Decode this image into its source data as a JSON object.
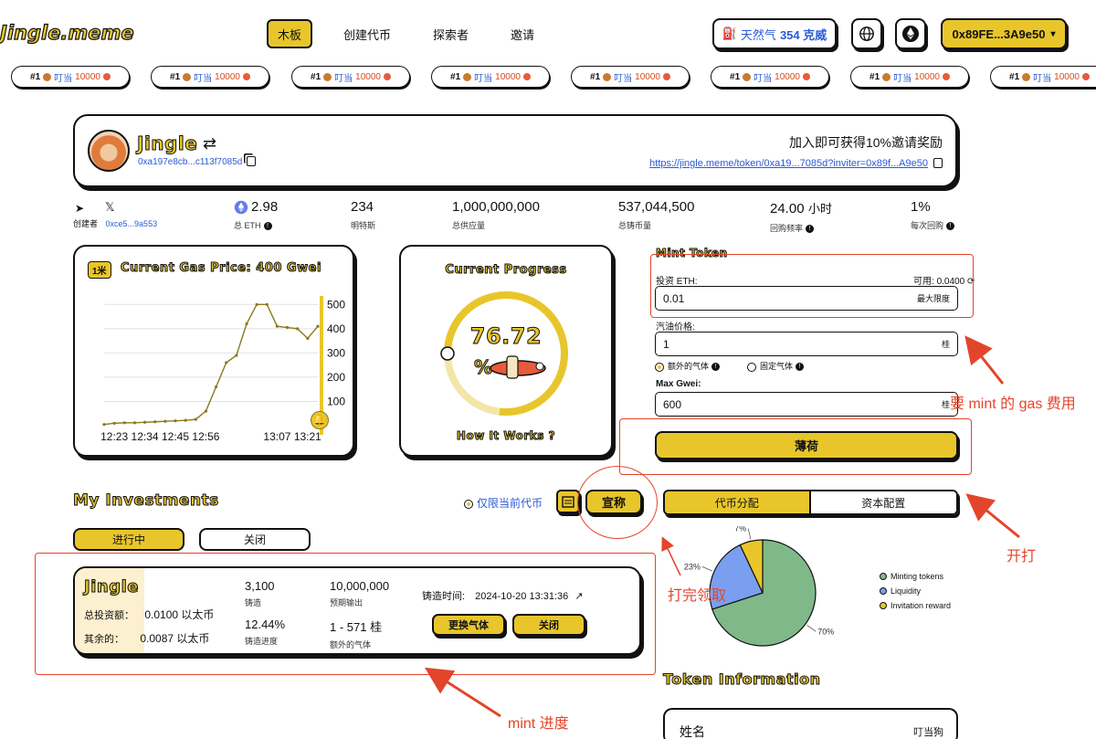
{
  "header": {
    "logo": "Jingle.meme",
    "nav": [
      "木板",
      "创建代币",
      "探索者",
      "邀请"
    ],
    "gas_label": "天然气",
    "gas_value": "354 克威",
    "wallet": "0x89FE...3A9e50"
  },
  "ticker": {
    "rank": "#1",
    "name": "叮当",
    "amount": "10000",
    "count": 8
  },
  "token_card": {
    "name": "Jingle",
    "address": "0xa197e8cb...c113f7085d",
    "invite_text": "加入即可获得10%邀请奖励",
    "invite_link": "https://jingle.meme/token/0xa19...7085d?inviter=0x89f...A9e50"
  },
  "stats": {
    "creator_label": "创建者",
    "creator": "0xce5...9a553",
    "eth_value": "2.98",
    "eth_label": "总 ETH",
    "mints_value": "234",
    "mints_label": "明特斯",
    "supply_value": "1,000,000,000",
    "supply_label": "总供应量",
    "minted_value": "537,044,500",
    "minted_label": "总铸币量",
    "freq_value": "24.00",
    "freq_unit": "小时",
    "freq_label": "回购频率",
    "buyback_value": "1%",
    "buyback_label": "每次回购"
  },
  "gas_chart_card": {
    "badge": "1米",
    "title": "Current Gas Price: 400 Gwei"
  },
  "chart_data": {
    "type": "line",
    "x": [
      "12:16",
      "12:23",
      "12:27",
      "12:31",
      "12:34",
      "12:38",
      "12:41",
      "12:45",
      "12:49",
      "12:52",
      "12:56",
      "12:59",
      "13:02",
      "13:06",
      "13:09",
      "13:11",
      "13:13",
      "13:15",
      "13:17",
      "13:19",
      "13:21",
      "13:23"
    ],
    "values": [
      5,
      10,
      12,
      12,
      14,
      16,
      18,
      20,
      22,
      26,
      60,
      160,
      260,
      290,
      420,
      500,
      500,
      410,
      405,
      400,
      360,
      410
    ],
    "xticks": [
      "12:23",
      "12:34",
      "12:45",
      "12:56",
      "13:07",
      "13:21"
    ],
    "yticks": [
      "100",
      "200",
      "300",
      "400",
      "500"
    ],
    "ylim": [
      0,
      520
    ],
    "color": "#8a7a1a"
  },
  "progress_card": {
    "title": "Current Progress",
    "percent": 76.72,
    "percent_text": "76.72",
    "percent_sign": "%",
    "footer": "How It Works ?"
  },
  "mint_form": {
    "title": "Mint Token",
    "invest_label": "投资 ETH:",
    "available_label": "可用:",
    "available_value": "0.0400",
    "invest_value": "0.01",
    "max_label": "最大限度",
    "gas_price_label": "汽油价格:",
    "gas_price_value": "1",
    "unit": "桂",
    "radio_extra": "额外的气体",
    "radio_fixed": "固定气体",
    "max_gwei_label": "Max Gwei:",
    "max_gwei_value": "600",
    "mint_button": "薄荷"
  },
  "investments": {
    "title": "My Investments",
    "filter_label": "仅限当前代币",
    "claim_button": "宣称",
    "tab_active": "进行中",
    "tab_closed": "关闭",
    "item": {
      "name": "Jingle",
      "total_label": "总投资额：",
      "total_value": "0.0100 以太币",
      "rest_label": "其余的：",
      "rest_value": "0.0087 以太币",
      "mint_count": "3,100",
      "mint_label": "铸造",
      "expected": "10,000,000",
      "expected_label": "预期输出",
      "progress_value": "12.44%",
      "progress_label": "铸造进度",
      "extra_gas": "1 - 571 桂",
      "extra_gas_label": "额外的气体",
      "time_label": "铸造时间:",
      "time_value": "2024-10-20 13:31:36",
      "btn_change": "更换气体",
      "btn_close": "关闭"
    }
  },
  "distribution": {
    "tab_active": "代币分配",
    "tab_other": "资本配置",
    "slices": [
      {
        "label": "Minting tokens",
        "value": 70,
        "pct": "70%",
        "color": "#7fb98a"
      },
      {
        "label": "Liquidity",
        "value": 23,
        "pct": "23%",
        "color": "#7a9ff0"
      },
      {
        "label": "Invitation reward",
        "value": 7,
        "pct": "7%",
        "color": "#e8c62b"
      }
    ]
  },
  "token_info": {
    "title": "Token Information",
    "name_label": "姓名",
    "name_value": "叮当狗"
  },
  "annotations": {
    "gas_fee": "要 mint 的 gas 费用",
    "start": "开打",
    "claim": "打完领取",
    "progress": "mint 进度"
  }
}
